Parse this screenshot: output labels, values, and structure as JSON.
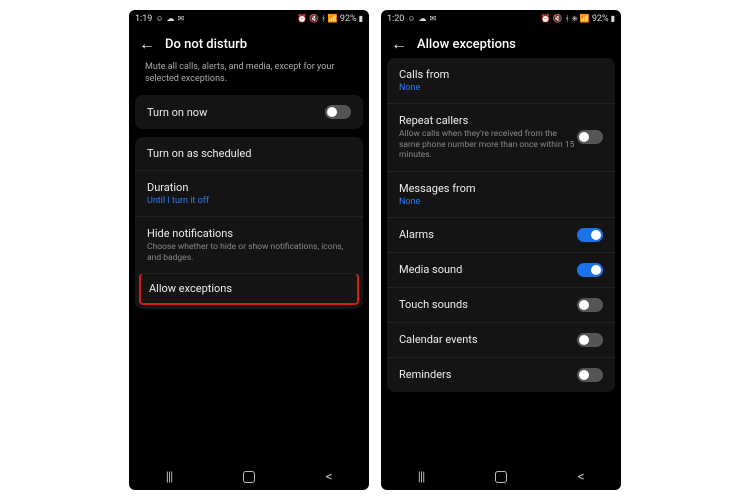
{
  "left": {
    "status": {
      "time": "1:19",
      "battery": "92%"
    },
    "title": "Do not disturb",
    "description": "Mute all calls, alerts, and media, except for your selected exceptions.",
    "turnOnNow": {
      "label": "Turn on now",
      "on": false
    },
    "schedule": {
      "label": "Turn on as scheduled"
    },
    "duration": {
      "label": "Duration",
      "value": "Until I turn it off"
    },
    "hideNotif": {
      "label": "Hide notifications",
      "sub": "Choose whether to hide or show notifications, icons, and badges."
    },
    "allowExceptions": {
      "label": "Allow exceptions"
    }
  },
  "right": {
    "status": {
      "time": "1:20",
      "battery": "92%"
    },
    "title": "Allow exceptions",
    "callsFrom": {
      "label": "Calls from",
      "value": "None"
    },
    "repeat": {
      "label": "Repeat callers",
      "sub": "Allow calls when they're received from the same phone number more than once within 15 minutes.",
      "on": false
    },
    "msgFrom": {
      "label": "Messages from",
      "value": "None"
    },
    "alarms": {
      "label": "Alarms",
      "on": true
    },
    "media": {
      "label": "Media sound",
      "on": true
    },
    "touch": {
      "label": "Touch sounds",
      "on": false
    },
    "calendar": {
      "label": "Calendar events",
      "on": false
    },
    "reminders": {
      "label": "Reminders",
      "on": false
    }
  }
}
